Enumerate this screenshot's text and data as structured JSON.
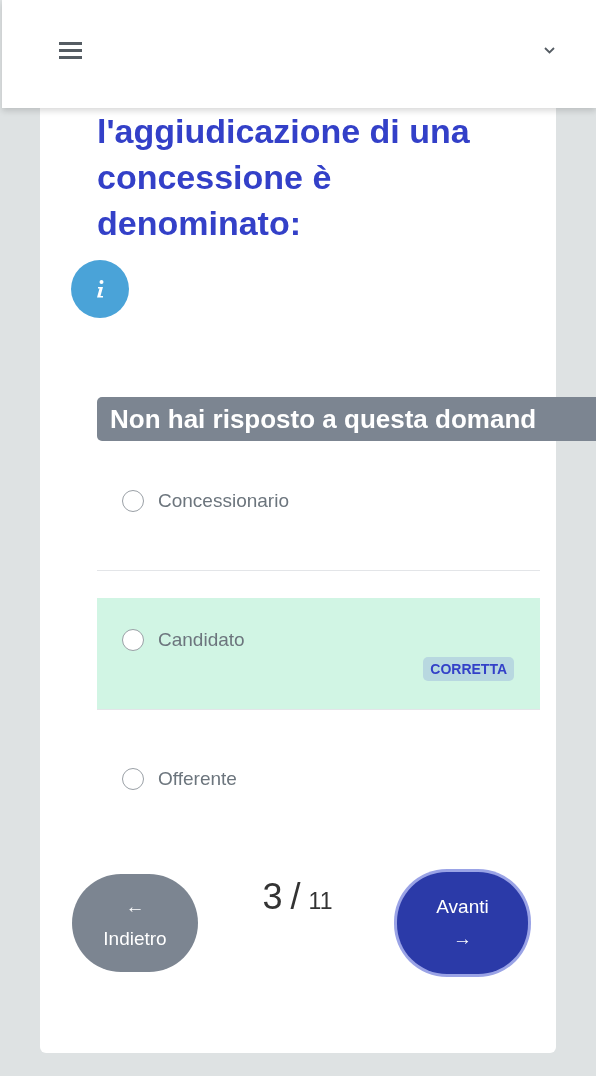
{
  "question": {
    "title": "l'aggiudicazione di una concessione è denominato:"
  },
  "notice": "Non hai risposto a questa domand",
  "options": [
    {
      "label": "Concessionario",
      "selected": false,
      "correct": false
    },
    {
      "label": "Candidato",
      "selected": false,
      "correct": true,
      "badge": "CORRETTA"
    },
    {
      "label": "Offerente",
      "selected": false,
      "correct": false
    }
  ],
  "pager": {
    "previous": {
      "arrow": "←",
      "label": "Indietro"
    },
    "current": "3",
    "separator": "/",
    "total": "11",
    "next": {
      "label": "Avanti",
      "arrow": "→"
    }
  }
}
